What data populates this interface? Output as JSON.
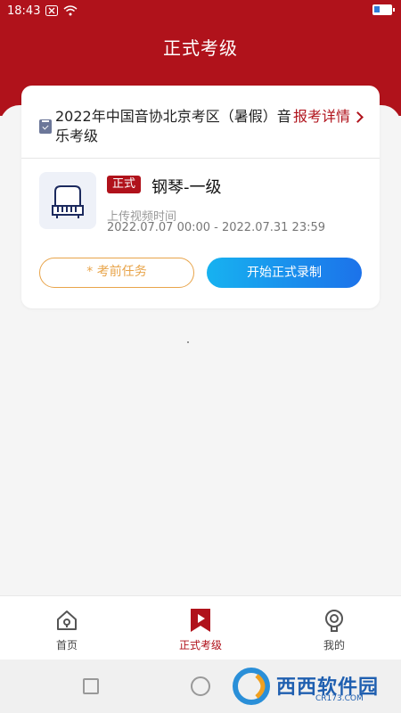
{
  "status_bar": {
    "time": "18:43"
  },
  "header": {
    "title": "正式考级"
  },
  "exam": {
    "name": "2022年中国音协北京考区（暑假）音乐考级",
    "detail_link": "报考详情"
  },
  "subject": {
    "tag": "正式",
    "name": "钢琴-一级",
    "upload_label": "上传视频时间",
    "upload_range": "2022.07.07 00:00 - 2022.07.31 23:59"
  },
  "actions": {
    "pre_task": "* 考前任务",
    "start_record": "开始正式录制"
  },
  "tabbar": {
    "items": [
      {
        "label": "首页",
        "icon": "home-icon"
      },
      {
        "label": "正式考级",
        "icon": "video-bookmark-icon",
        "active": true
      },
      {
        "label": "我的",
        "icon": "profile-icon"
      }
    ]
  },
  "watermark": {
    "text": "西西软件园",
    "sub": "CR173.COM"
  },
  "colors": {
    "brand": "#b0121b",
    "accent_blue": "#1c72ea",
    "accent_orange": "#e8a44a"
  }
}
